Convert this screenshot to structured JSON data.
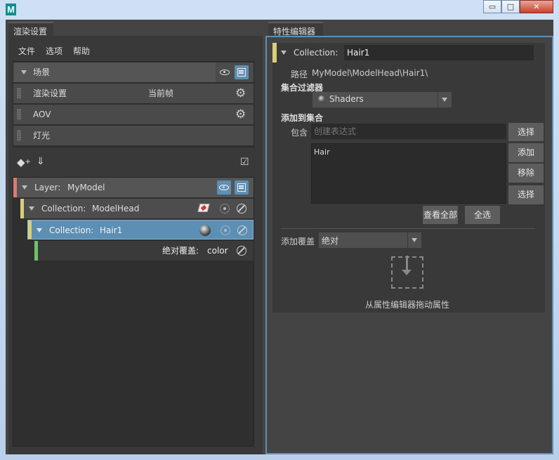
{
  "window": {
    "min": "▭",
    "max": "□",
    "close": "✕"
  },
  "left": {
    "tab": "渲染设置",
    "menu": [
      "文件",
      "选项",
      "帮助"
    ],
    "scene": {
      "label": "场景"
    },
    "render_settings": {
      "label": "渲染设置",
      "value": "当前帧"
    },
    "aov": {
      "label": "AOV"
    },
    "lights": {
      "label": "灯光"
    },
    "layer": {
      "prefix": "Layer:",
      "name": "MyModel"
    },
    "coll1": {
      "prefix": "Collection:",
      "name": "ModelHead"
    },
    "coll2": {
      "prefix": "Collection:",
      "name": "Hair1"
    },
    "override": {
      "label": "绝对覆盖:",
      "value": "color"
    },
    "colors": {
      "layer": "#d97a72",
      "coll1": "#d8cf7a",
      "coll2": "#d8cf7a",
      "override": "#6fbf6f",
      "selected": "#5b8fb3"
    }
  },
  "right": {
    "tab": "特性编辑器",
    "collection_prefix": "Collection:",
    "collection_name": "Hair1",
    "path_label": "路径",
    "path_value": "MyModel\\ModelHead\\Hair1\\",
    "filter_label": "集合过滤器",
    "filter_value": "Shaders",
    "add_to_collection": "添加到集合",
    "include_label": "包含",
    "include_placeholder": "创建表达式",
    "select_btn": "选择",
    "list_items": [
      "Hair"
    ],
    "add_btn": "添加",
    "remove_btn": "移除",
    "select_btn2": "选择",
    "view_all": "查看全部",
    "select_all": "全选",
    "add_override_label": "添加覆盖",
    "add_override_value": "绝对",
    "drop_hint": "从属性编辑器拖动属性"
  }
}
